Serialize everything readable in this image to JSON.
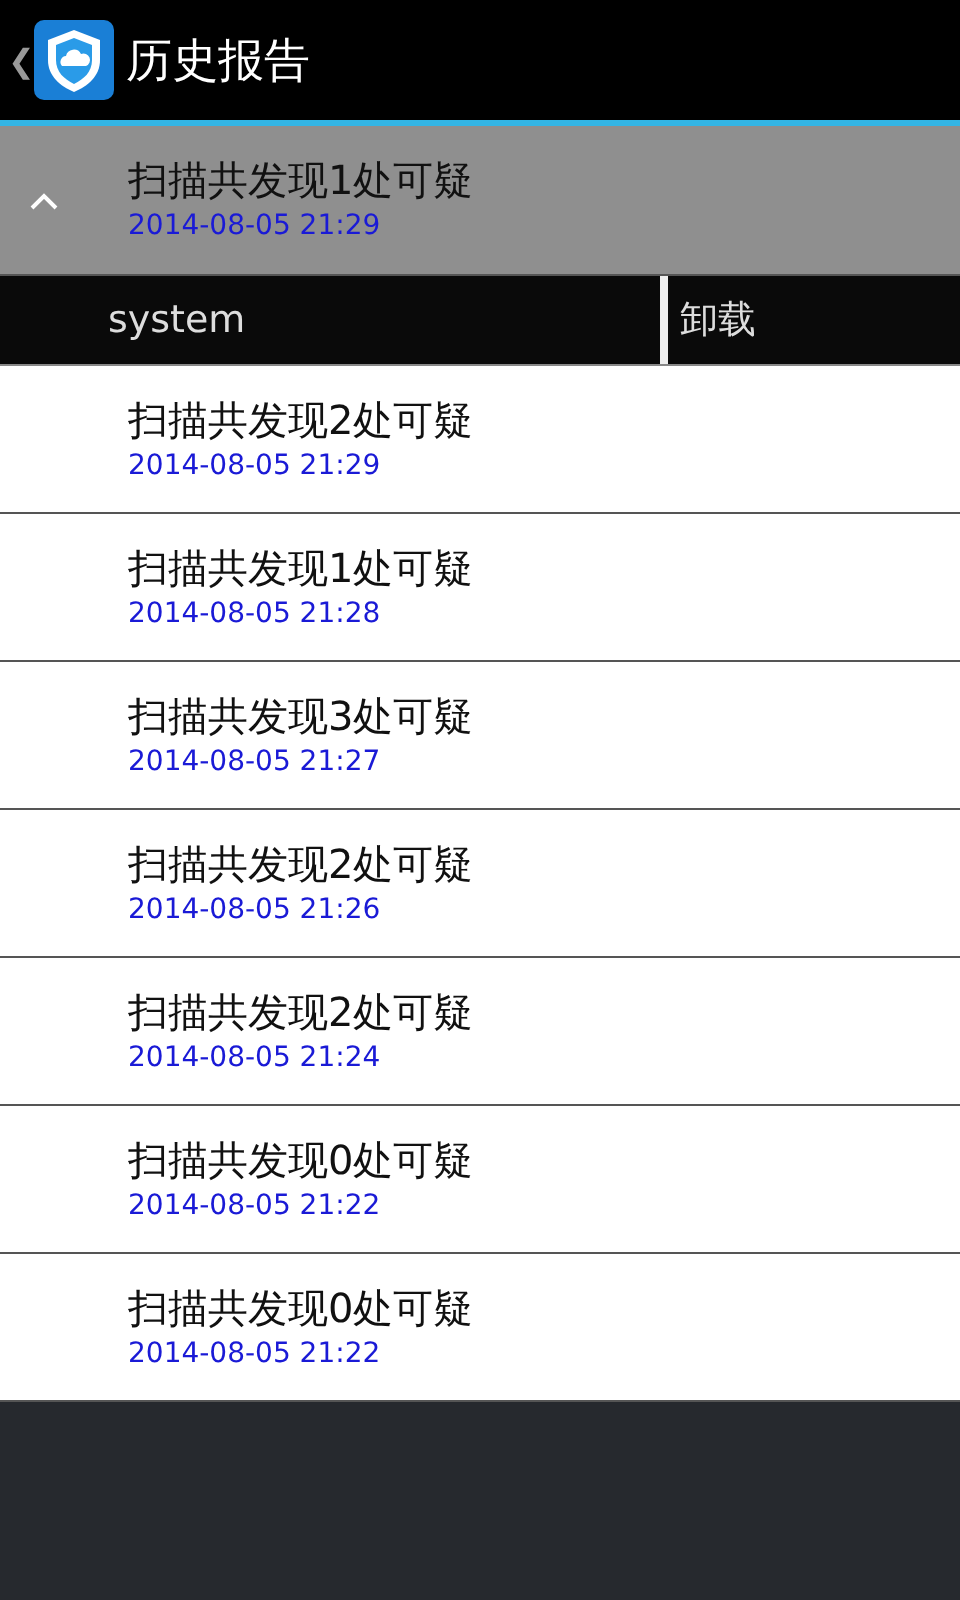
{
  "header": {
    "back": "❮",
    "title": "历史报告"
  },
  "reports": [
    {
      "title": "扫描共发现1处可疑",
      "time": "2014-08-05 21:29",
      "expanded": true,
      "items": [
        {
          "name": "system",
          "action": "卸载"
        }
      ]
    },
    {
      "title": "扫描共发现2处可疑",
      "time": "2014-08-05 21:29",
      "expanded": false
    },
    {
      "title": "扫描共发现1处可疑",
      "time": "2014-08-05 21:28",
      "expanded": false
    },
    {
      "title": "扫描共发现3处可疑",
      "time": "2014-08-05 21:27",
      "expanded": false
    },
    {
      "title": "扫描共发现2处可疑",
      "time": "2014-08-05 21:26",
      "expanded": false
    },
    {
      "title": "扫描共发现2处可疑",
      "time": "2014-08-05 21:24",
      "expanded": false
    },
    {
      "title": "扫描共发现0处可疑",
      "time": "2014-08-05 21:22",
      "expanded": false
    },
    {
      "title": "扫描共发现0处可疑",
      "time": "2014-08-05 21:22",
      "expanded": false
    }
  ]
}
